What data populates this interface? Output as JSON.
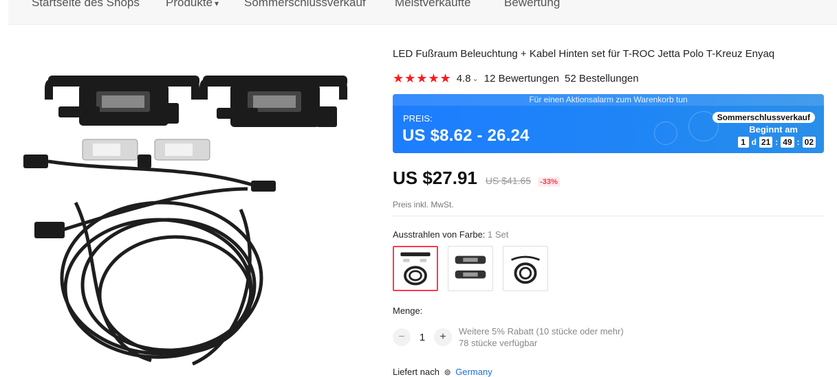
{
  "nav": {
    "items": [
      {
        "label": "Startseite des Shops"
      },
      {
        "label": "Produkte",
        "has_dropdown": true
      },
      {
        "label": "Sommerschlussverkauf"
      },
      {
        "label": "Meistverkaufte"
      },
      {
        "label": "Bewertung"
      }
    ]
  },
  "product": {
    "image_icon": "product-photo",
    "title": "LED Fußraum Beleuchtung + Kabel Hinten set für T-ROC Jetta Polo T-Kreuz Enyaq",
    "stars": "★★★★★",
    "rating": "4.8",
    "reviews": "12 Bewertungen",
    "orders": "52 Bestellungen"
  },
  "promo": {
    "banner_text": "Für einen Aktionsalarm zum Warenkorb tun",
    "price_label": "PREIS:",
    "price_range": "US $8.62 - 26.24",
    "event_badge": "Sommerschlussverkauf",
    "begins_label": "Beginnt am",
    "countdown": {
      "days": "1",
      "day_unit": "d",
      "hours": "21",
      "minutes": "49",
      "seconds": "02"
    },
    "color": "#1d7dff"
  },
  "pricing": {
    "current": "US $27.91",
    "original": "US $41.65",
    "discount": "-33%",
    "tax_note": "Preis inkl. MwSt."
  },
  "variants": {
    "label": "Ausstrahlen von Farbe:",
    "selected_value": "1 Set",
    "options": [
      {
        "icon": "set-full-thumbnail",
        "selected": true
      },
      {
        "icon": "brackets-thumbnail",
        "selected": false
      },
      {
        "icon": "cable-thumbnail",
        "selected": false
      }
    ]
  },
  "quantity": {
    "label": "Menge:",
    "value": "1",
    "minus": "−",
    "plus": "+",
    "discount_note": "Weitere 5% Rabatt (10 stücke oder mehr)",
    "stock_note": "78 stücke verfügbar"
  },
  "shipping": {
    "label": "Liefert nach",
    "pin_icon": "location-pin-icon",
    "country": "Germany"
  },
  "colors": {
    "accent_red": "#fd384f",
    "star_red": "#ff1a1a",
    "link_blue": "#1a6fe0"
  }
}
